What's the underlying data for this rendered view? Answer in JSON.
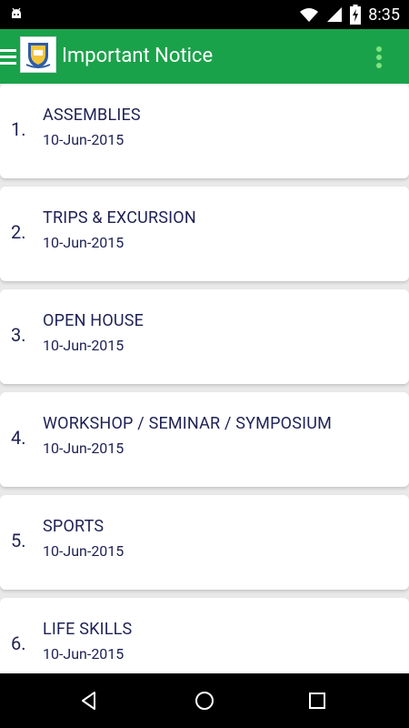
{
  "status_bar": {
    "time": "8:35",
    "icons": [
      "android-icon",
      "wifi-icon",
      "signal-icon",
      "battery-charging-icon"
    ]
  },
  "app_bar": {
    "title": "Important Notice",
    "menu_icon": "hamburger-icon",
    "logo": "school-logo",
    "overflow_icon": "more-vertical-icon"
  },
  "notices": [
    {
      "num": "1.",
      "title": "ASSEMBLIES",
      "date": "10-Jun-2015"
    },
    {
      "num": "2.",
      "title": "TRIPS & EXCURSION",
      "date": "10-Jun-2015"
    },
    {
      "num": "3.",
      "title": "OPEN HOUSE",
      "date": "10-Jun-2015"
    },
    {
      "num": "4.",
      "title": "WORKSHOP / SEMINAR / SYMPOSIUM",
      "date": "10-Jun-2015"
    },
    {
      "num": "5.",
      "title": "SPORTS",
      "date": "10-Jun-2015"
    },
    {
      "num": "6.",
      "title": "LIFE SKILLS",
      "date": "10-Jun-2015"
    }
  ],
  "nav_bar": {
    "icons": [
      "back-icon",
      "home-icon",
      "recents-icon"
    ]
  },
  "colors": {
    "app_bar": "#1aa24a",
    "text": "#1e2154",
    "background": "#e9e9e9"
  }
}
